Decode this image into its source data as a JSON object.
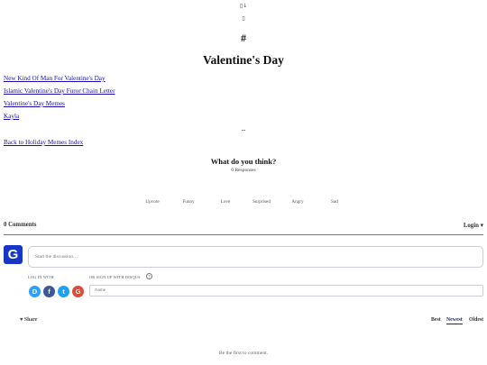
{
  "top_icons": {
    "first": "▯↓",
    "second": "▯"
  },
  "page": {
    "hash": "#",
    "title": "Valentine's Day",
    "links": [
      "New Kind Of Man For Valentine's Day",
      "Islamic Valentine's Day Furor Chain Letter",
      "Valentine's Day Memes",
      "Kayla"
    ],
    "separator": "--",
    "back_link": "Back to Holiday Memes Index"
  },
  "reactions": {
    "question": "What do you think?",
    "responses": "0 Responses",
    "items": [
      "Upvote",
      "Funny",
      "Love",
      "Surprised",
      "Angry",
      "Sad"
    ]
  },
  "comments": {
    "count_label": "0 Comments",
    "login_label": "Login ▾",
    "avatar_letter": "G",
    "editor_placeholder": "Start the discussion…",
    "login_with": "LOG IN WITH",
    "signup_with": "OR SIGN UP WITH DISQUS",
    "help": "?",
    "social": [
      {
        "letter": "D",
        "name": "disqus",
        "color": "#2e9fff"
      },
      {
        "letter": "f",
        "name": "facebook",
        "color": "#3b5998"
      },
      {
        "letter": "t",
        "name": "twitter",
        "color": "#1da1f2"
      },
      {
        "letter": "G",
        "name": "google",
        "color": "#dd4b39"
      }
    ],
    "name_placeholder": "Name",
    "share_label": "♥ Share",
    "sort": {
      "best": "Best",
      "newest": "Newest",
      "oldest": "Oldest",
      "active": "Newest"
    },
    "empty": "Be the first to comment."
  }
}
